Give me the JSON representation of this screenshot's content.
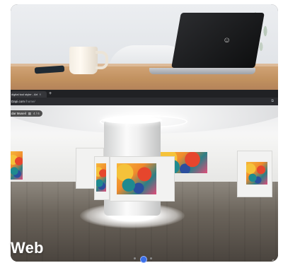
{
  "browser": {
    "tab_title": "digital tool styler - Art",
    "tab_close": "✕",
    "new_tab": "+",
    "url_main": "Dapi.com",
    "url_path": "/home/",
    "extension_icon": "puzzle-icon"
  },
  "gallery": {
    "breadcrumb": {
      "title": "dar Museil",
      "count": "4 / 6"
    }
  },
  "caption": {
    "label": "Web"
  },
  "colors": {
    "accent": "#3a6fe8",
    "table": "#c1915f",
    "laptop": "#1b1c1e"
  },
  "icons": [
    "smile-logo-icon",
    "share-icon",
    "fullscreen-icon"
  ]
}
